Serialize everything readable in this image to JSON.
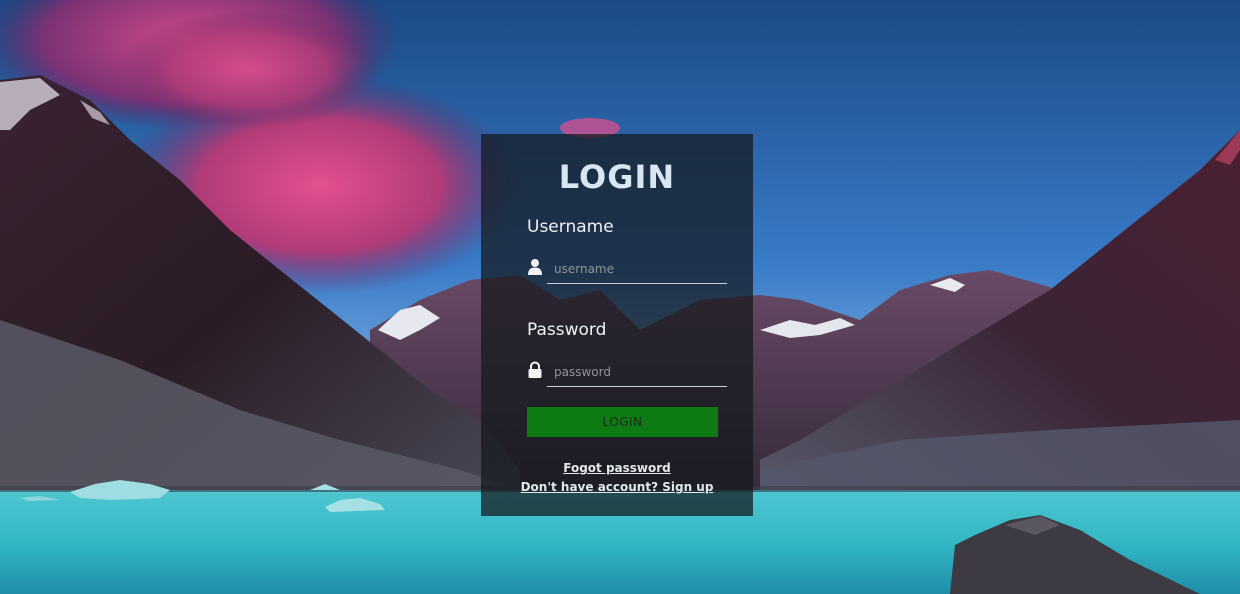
{
  "login": {
    "title": "LOGIN",
    "username_label": "Username",
    "username_placeholder": "username",
    "password_label": "Password",
    "password_placeholder": "password",
    "submit_label": "LOGIN",
    "forgot_password": "Fogot password",
    "signup_link": "Don't have account? Sign up"
  },
  "icons": {
    "username": "user-icon",
    "password": "lock-icon"
  },
  "colors": {
    "card_background": "rgba(20,24,28,0.72)",
    "title": "#d8e6f2",
    "button": "#0d7a12",
    "lake": "#3fcfd6",
    "sky": "#2a5f9e",
    "cloud": "#c24a86"
  }
}
